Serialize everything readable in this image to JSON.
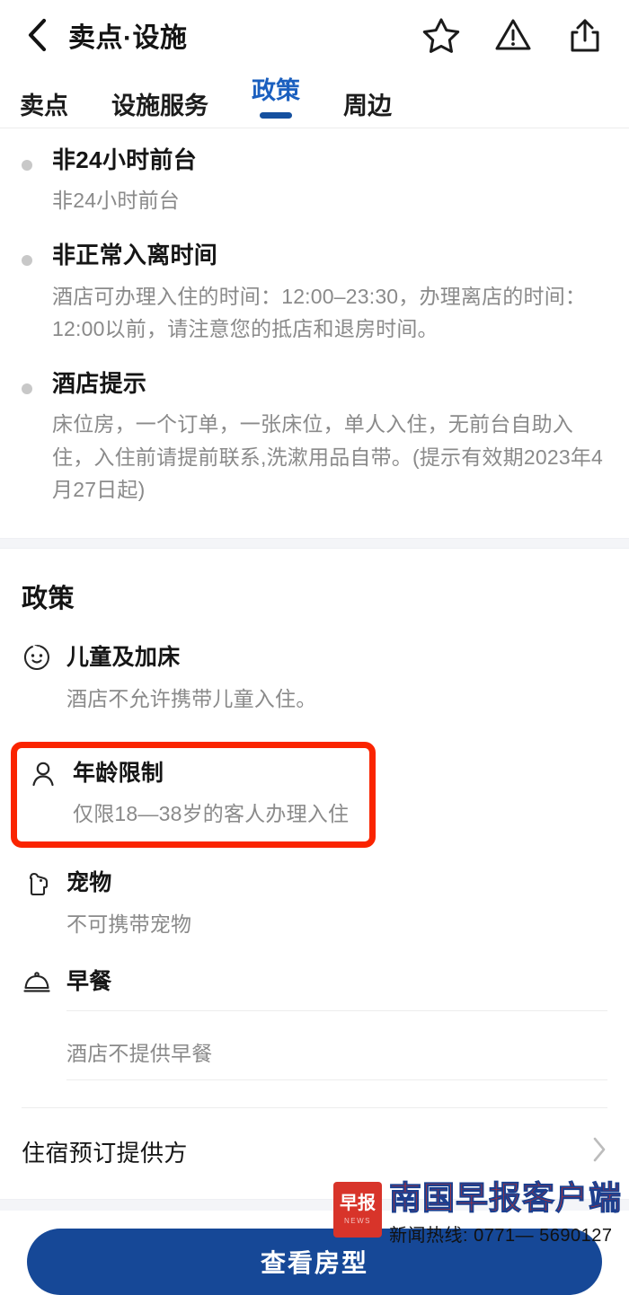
{
  "header": {
    "back_icon": "chevron-left-icon",
    "title": "卖点·设施",
    "actions": [
      {
        "icon": "star-icon",
        "name": "favorite"
      },
      {
        "icon": "warning-triangle-icon",
        "name": "report"
      },
      {
        "icon": "share-icon",
        "name": "share"
      }
    ]
  },
  "tabs": [
    {
      "label": "卖点",
      "active": false
    },
    {
      "label": "设施服务",
      "active": false
    },
    {
      "label": "政策",
      "active": true
    },
    {
      "label": "周边",
      "active": false
    }
  ],
  "notices": [
    {
      "title": "非24小时前台",
      "desc": "非24小时前台"
    },
    {
      "title": "非正常入离时间",
      "desc": "酒店可办理入住的时间：12:00–23:30，办理离店的时间：12:00以前，请注意您的抵店和退房时间。"
    },
    {
      "title": "酒店提示",
      "desc": "床位房，一个订单，一张床位，单人入住，无前台自助入住，入住前请提前联系,洗漱用品自带。(提示有效期2023年4月27日起)"
    }
  ],
  "policy": {
    "section_title": "政策",
    "items": [
      {
        "icon": "child-face-icon",
        "name": "儿童及加床",
        "desc": "酒店不允许携带儿童入住。",
        "highlighted": false
      },
      {
        "icon": "person-icon",
        "name": "年龄限制",
        "desc": "仅限18—38岁的客人办理入住",
        "highlighted": true
      },
      {
        "icon": "pet-dog-icon",
        "name": "宠物",
        "desc": "不可携带宠物",
        "highlighted": false
      },
      {
        "icon": "cloche-icon",
        "name": "早餐",
        "desc": "酒店不提供早餐",
        "highlighted": false
      }
    ]
  },
  "provider": {
    "label": "住宿预订提供方",
    "chevron_icon": "chevron-right-icon"
  },
  "cta": {
    "label": "查看房型"
  },
  "watermark": {
    "badge_text": "早报",
    "badge_sub": "NEWS",
    "title": "南国早报客户端",
    "hotline": "新闻热线: 0771— 5690127"
  },
  "colors": {
    "accent_blue": "#15509f",
    "tab_active": "#1a5fbf",
    "cta_blue": "#164897",
    "highlight_red": "#fa2400",
    "watermark_red": "#cf2a22",
    "muted_text": "#8a8a8a"
  }
}
